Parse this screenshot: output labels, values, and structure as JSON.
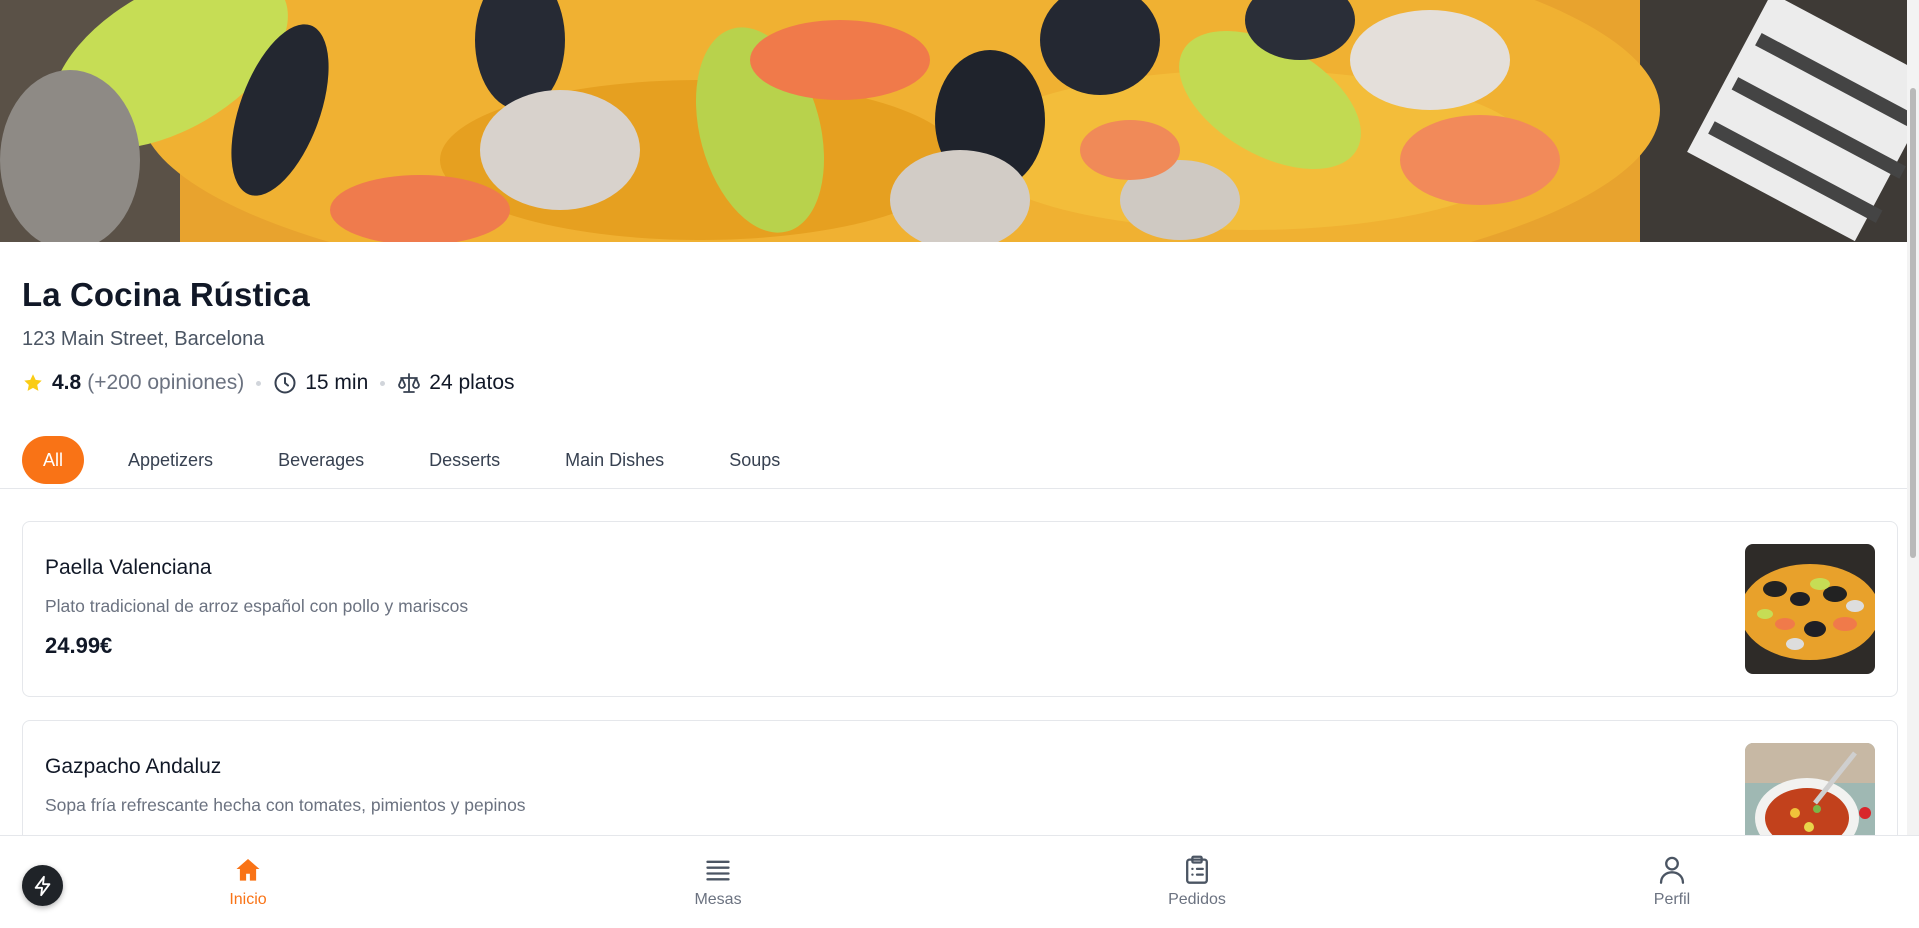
{
  "restaurant": {
    "name": "La Cocina Rústica",
    "address": "123 Main Street, Barcelona",
    "rating": "4.8",
    "reviews": "(+200 opiniones)",
    "delivery_time": "15 min",
    "dish_count": "24 platos"
  },
  "tabs": [
    {
      "label": "All",
      "active": true
    },
    {
      "label": "Appetizers",
      "active": false
    },
    {
      "label": "Beverages",
      "active": false
    },
    {
      "label": "Desserts",
      "active": false
    },
    {
      "label": "Main Dishes",
      "active": false
    },
    {
      "label": "Soups",
      "active": false
    }
  ],
  "menu": [
    {
      "name": "Paella Valenciana",
      "description": "Plato tradicional de arroz español con pollo y mariscos",
      "price": "24.99€",
      "image": "paella-image"
    },
    {
      "name": "Gazpacho Andaluz",
      "description": "Sopa fría refrescante hecha con tomates, pimientos y pepinos",
      "price": "",
      "image": "soup-image"
    }
  ],
  "bottom_nav": [
    {
      "label": "Inicio",
      "icon": "home-icon",
      "active": true
    },
    {
      "label": "Mesas",
      "icon": "menu-lines-icon",
      "active": false
    },
    {
      "label": "Pedidos",
      "icon": "clipboard-icon",
      "active": false
    },
    {
      "label": "Perfil",
      "icon": "user-icon",
      "active": false
    }
  ],
  "colors": {
    "accent": "#f97316",
    "star": "#facc15",
    "text_primary": "#111827",
    "text_secondary": "#6b7280"
  }
}
